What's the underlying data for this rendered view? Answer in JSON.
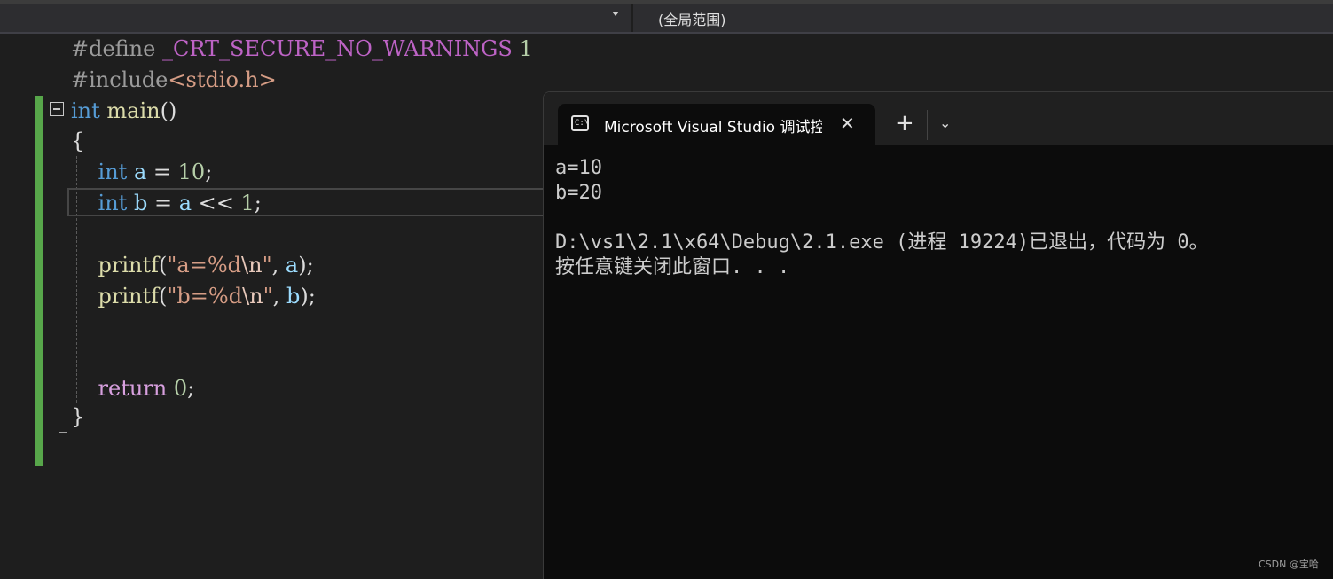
{
  "toolbar": {
    "scope_label": "(全局范围)"
  },
  "editor": {
    "line1": {
      "directive": "#define",
      "macro": "_CRT_SECURE_NO_WARNINGS",
      "value": "1"
    },
    "line2": {
      "directive": "#include",
      "header": "<stdio.h>"
    },
    "line3": {
      "type": "int",
      "name": "main",
      "parens": "()"
    },
    "line4": "{",
    "line5": {
      "type": "int",
      "var": "a",
      "eq": "=",
      "num": "10",
      "semi": ";"
    },
    "line6": {
      "type": "int",
      "var": "b",
      "eq": "=",
      "var2": "a",
      "op": "<<",
      "num": "1",
      "semi": ";"
    },
    "line7": {
      "fn": "printf",
      "open": "(",
      "str_a": "\"a=%d",
      "esc": "\\n",
      "str_b": "\"",
      "comma": ",",
      "arg": "a",
      "close": ");"
    },
    "line8": {
      "fn": "printf",
      "open": "(",
      "str_a": "\"b=%d",
      "esc": "\\n",
      "str_b": "\"",
      "comma": ",",
      "arg": "b",
      "close": ");"
    },
    "line9": {
      "kw": "return",
      "num": "0",
      "semi": ";"
    },
    "line10": "}"
  },
  "terminal": {
    "tab_title": "Microsoft Visual Studio 调试控制台",
    "icon_text": "C:\\",
    "close_glyph": "✕",
    "new_tab_glyph": "+",
    "dropdown_glyph": "⌄",
    "output": [
      "a=10",
      "b=20",
      "",
      "D:\\vs1\\2.1\\x64\\Debug\\2.1.exe (进程 19224)已退出，代码为 0。",
      "按任意键关闭此窗口. . ."
    ]
  },
  "watermark": "CSDN @宝哈"
}
